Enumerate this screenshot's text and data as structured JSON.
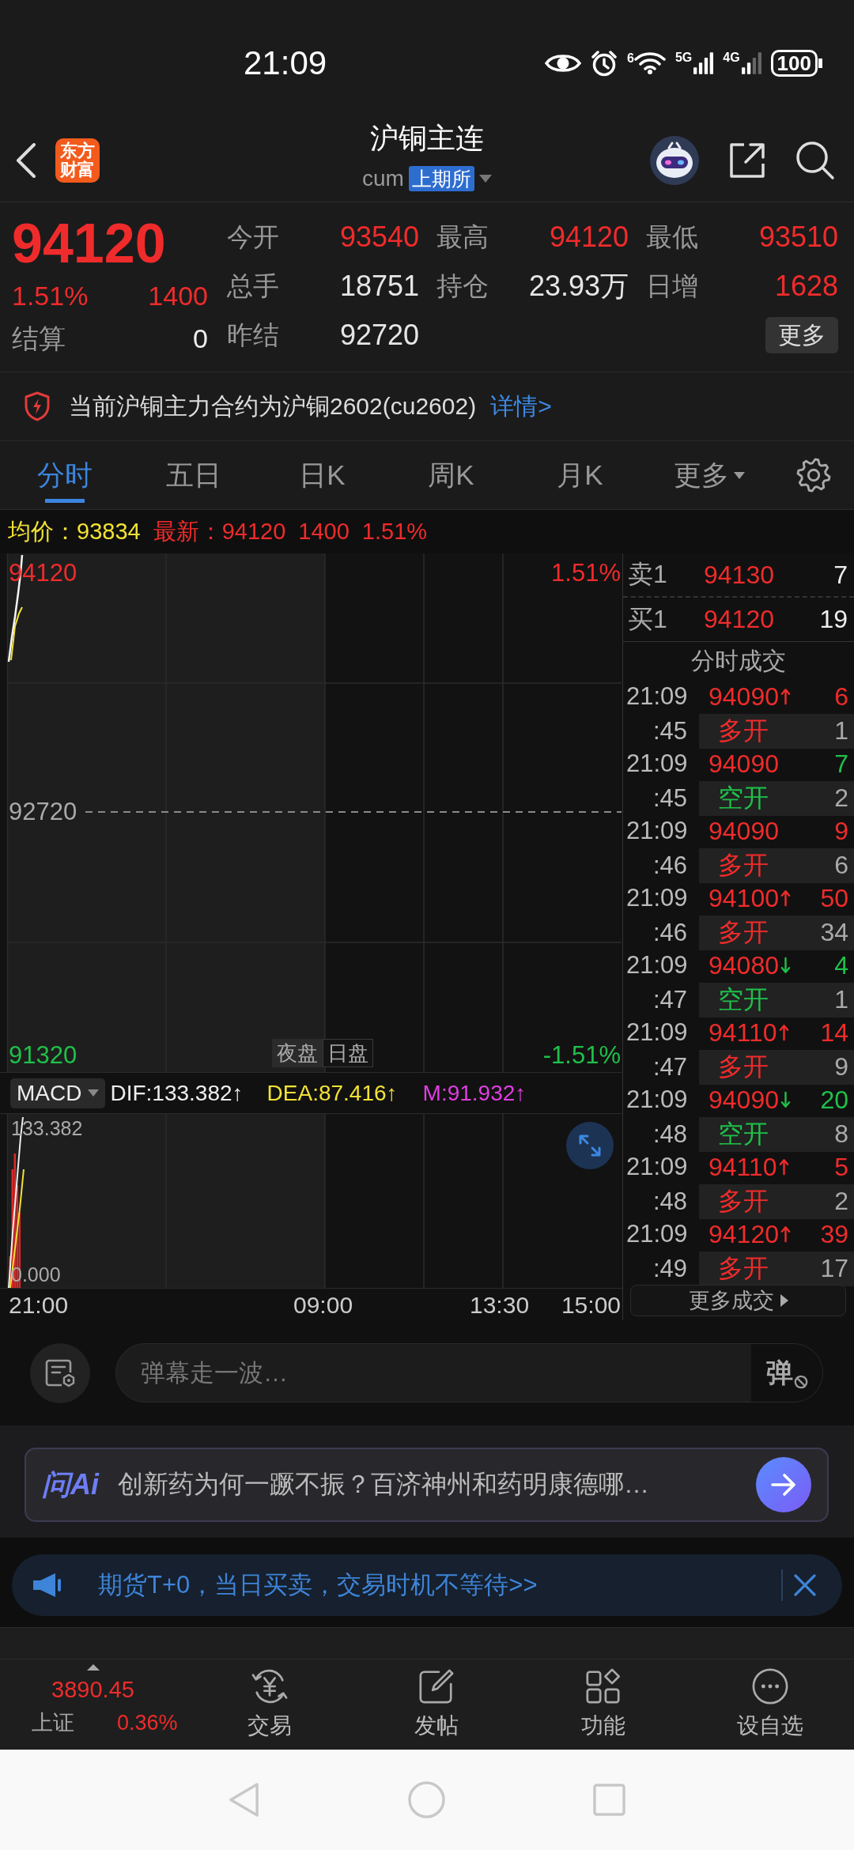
{
  "status_bar": {
    "time": "21:09",
    "wifi_standard": "6",
    "networks": [
      "5G",
      "4G"
    ],
    "battery": "100"
  },
  "header": {
    "logo": "东方财富",
    "title": "沪铜主连",
    "code": "cum",
    "exchange": "上期所"
  },
  "quote": {
    "price": "94120",
    "change_pct": "1.51%",
    "change": "1400",
    "up": true,
    "settlement_label": "结算",
    "settlement": "0",
    "more_button": "更多",
    "stats": [
      {
        "label": "今开",
        "value": "93540",
        "color": "#f02b2b"
      },
      {
        "label": "最高",
        "value": "94120",
        "color": "#f02b2b"
      },
      {
        "label": "最低",
        "value": "93510",
        "color": "#f02b2b"
      },
      {
        "label": "总手",
        "value": "18751",
        "color": "#e6e6e6"
      },
      {
        "label": "持仓",
        "value": "23.93万",
        "color": "#e6e6e6"
      },
      {
        "label": "日增",
        "value": "1628",
        "color": "#f02b2b"
      },
      {
        "label": "昨结",
        "value": "92720",
        "color": "#e6e6e6"
      }
    ]
  },
  "notice": {
    "text": "当前沪铜主力合约为沪铜2602(cu2602)",
    "link": "详情>"
  },
  "chart_tabs": [
    {
      "label": "分时",
      "selected": true,
      "kind": "period"
    },
    {
      "label": "五日",
      "selected": false,
      "kind": "period"
    },
    {
      "label": "日K",
      "selected": false,
      "kind": "period"
    },
    {
      "label": "周K",
      "selected": false,
      "kind": "period"
    },
    {
      "label": "月K",
      "selected": false,
      "kind": "period"
    },
    {
      "label": "更多",
      "selected": false,
      "kind": "menu"
    }
  ],
  "price_line": {
    "avg_label": "均价：",
    "avg": "93834",
    "latest_label": "最新：",
    "latest": "94120",
    "change": "1400",
    "change_pct": "1.51%"
  },
  "price_chart": {
    "high": "94120",
    "high_pct": "1.51%",
    "base": "92720",
    "low": "91320",
    "low_pct": "-1.51%",
    "sessions": [
      {
        "label": "夜盘",
        "kind": "night"
      },
      {
        "label": "日盘",
        "kind": "day"
      }
    ]
  },
  "macd": {
    "indicator": "MACD",
    "dif": "DIF:133.382↑",
    "dea": "DEA:87.416↑",
    "m": "M:91.932↑",
    "max": "133.382",
    "min": "0.000"
  },
  "time_axis": [
    "21:00",
    "09:00",
    "13:30",
    "15:00"
  ],
  "order_book": [
    {
      "side_label": "卖1",
      "price": "94130",
      "volume": "7"
    },
    {
      "side_label": "买1",
      "price": "94120",
      "volume": "19"
    }
  ],
  "trades_title": "分时成交",
  "trades": [
    {
      "time": "21:09",
      "seconds": ":45",
      "price": "94090",
      "uptick": true,
      "downtick": false,
      "volume": "6",
      "color": "#f02b2b",
      "open_type": "多开",
      "open_volume": "1"
    },
    {
      "time": "21:09",
      "seconds": ":45",
      "price": "94090",
      "uptick": false,
      "downtick": false,
      "volume": "7",
      "color": "#1fc04a",
      "open_type": "空开",
      "open_volume": "2"
    },
    {
      "time": "21:09",
      "seconds": ":46",
      "price": "94090",
      "uptick": false,
      "downtick": false,
      "volume": "9",
      "color": "#f02b2b",
      "open_type": "多开",
      "open_volume": "6"
    },
    {
      "time": "21:09",
      "seconds": ":46",
      "price": "94100",
      "uptick": true,
      "downtick": false,
      "volume": "50",
      "color": "#f02b2b",
      "open_type": "多开",
      "open_volume": "34"
    },
    {
      "time": "21:09",
      "seconds": ":47",
      "price": "94080",
      "uptick": false,
      "downtick": true,
      "volume": "4",
      "color": "#1fc04a",
      "open_type": "空开",
      "open_volume": "1"
    },
    {
      "time": "21:09",
      "seconds": ":47",
      "price": "94110",
      "uptick": true,
      "downtick": false,
      "volume": "14",
      "color": "#f02b2b",
      "open_type": "多开",
      "open_volume": "9"
    },
    {
      "time": "21:09",
      "seconds": ":48",
      "price": "94090",
      "uptick": false,
      "downtick": true,
      "volume": "20",
      "color": "#1fc04a",
      "open_type": "空开",
      "open_volume": "8"
    },
    {
      "time": "21:09",
      "seconds": ":48",
      "price": "94110",
      "uptick": true,
      "downtick": false,
      "volume": "5",
      "color": "#f02b2b",
      "open_type": "多开",
      "open_volume": "2"
    },
    {
      "time": "21:09",
      "seconds": ":49",
      "price": "94120",
      "uptick": true,
      "downtick": false,
      "volume": "39",
      "color": "#f02b2b",
      "open_type": "多开",
      "open_volume": "17"
    }
  ],
  "more_trades": "更多成交",
  "danmaku": {
    "placeholder": "弹幕走一波…",
    "toggle": "弹"
  },
  "ask_ai": {
    "logo": "问Ai",
    "question": "创新药为何一蹶不振？百济神州和药明康德哪…"
  },
  "promo": {
    "text": "期货T+0，当日买卖，交易时机不等待>>"
  },
  "bottom_nav": {
    "index": {
      "value": "3890.45",
      "name": "上证",
      "change_pct": "0.36%",
      "up": true
    },
    "items": [
      {
        "label": "交易",
        "kind": "trade"
      },
      {
        "label": "发帖",
        "kind": "post"
      },
      {
        "label": "功能",
        "kind": "apps"
      },
      {
        "label": "设自选",
        "kind": "more"
      }
    ]
  }
}
